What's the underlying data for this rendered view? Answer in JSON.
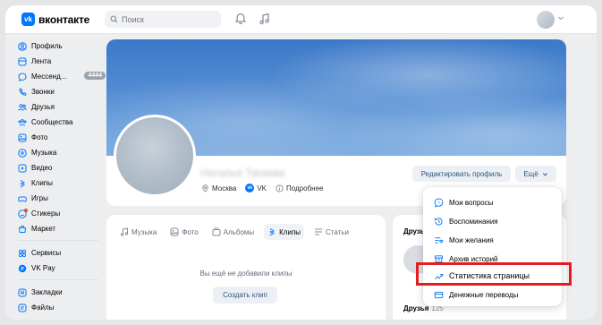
{
  "header": {
    "logo_text": "вконтакте",
    "logo_mark": "vk",
    "search_placeholder": "Поиск",
    "icons": [
      "search-icon",
      "bell-icon",
      "music-icon",
      "chevron-down-icon"
    ]
  },
  "sidebar": {
    "items": [
      {
        "label": "Профиль",
        "icon": "profile-icon"
      },
      {
        "label": "Лента",
        "icon": "feed-icon"
      },
      {
        "label": "Мессенд...",
        "icon": "messenger-icon",
        "badge": "4444"
      },
      {
        "label": "Звонки",
        "icon": "phone-icon"
      },
      {
        "label": "Друзья",
        "icon": "friends-icon"
      },
      {
        "label": "Сообщества",
        "icon": "communities-icon"
      },
      {
        "label": "Фото",
        "icon": "photo-icon"
      },
      {
        "label": "Музыка",
        "icon": "music-icon"
      },
      {
        "label": "Видео",
        "icon": "video-icon"
      },
      {
        "label": "Клипы",
        "icon": "clips-icon"
      },
      {
        "label": "Игры",
        "icon": "games-icon"
      },
      {
        "label": "Стикеры",
        "icon": "stickers-icon"
      },
      {
        "label": "Маркет",
        "icon": "market-icon"
      }
    ],
    "items2": [
      {
        "label": "Сервисы",
        "icon": "services-icon"
      },
      {
        "label": "VK Pay",
        "icon": "vkpay-icon"
      }
    ],
    "items3": [
      {
        "label": "Закладки",
        "icon": "bookmarks-icon"
      },
      {
        "label": "Файлы",
        "icon": "files-icon"
      }
    ]
  },
  "profile": {
    "name": "Наталья Тагаева",
    "city": "Москва",
    "vk_label": "VK",
    "details_label": "Подробнее",
    "edit_label": "Редактировать профиль",
    "more_label": "Ещё"
  },
  "content": {
    "tabs": [
      {
        "label": "Музыка",
        "icon": "music-icon"
      },
      {
        "label": "Фото",
        "icon": "photo-icon"
      },
      {
        "label": "Альбомы",
        "icon": "albums-icon"
      },
      {
        "label": "Клипы",
        "icon": "clips-icon",
        "active": true
      },
      {
        "label": "Статьи",
        "icon": "articles-icon"
      }
    ],
    "empty_text": "Вы ещё не добавили клипы",
    "create_label": "Создать клип"
  },
  "friends": {
    "title": "Друзья",
    "title2": "Друзья",
    "count2": "125"
  },
  "dropdown": {
    "items": [
      {
        "label": "Мои вопросы",
        "icon": "questions-icon"
      },
      {
        "label": "Воспоминания",
        "icon": "memories-icon"
      },
      {
        "label": "Мои желания",
        "icon": "wishes-icon"
      },
      {
        "label": "Архив историй",
        "icon": "archive-icon"
      },
      {
        "label": "Статистика страницы",
        "icon": "stats-icon"
      },
      {
        "label": "Денежные переводы",
        "icon": "money-transfer-icon"
      }
    ],
    "highlight_color": "#e21d1d"
  },
  "colors": {
    "accent": "#0077ff",
    "link": "#2a5885",
    "background": "#edeef0"
  }
}
